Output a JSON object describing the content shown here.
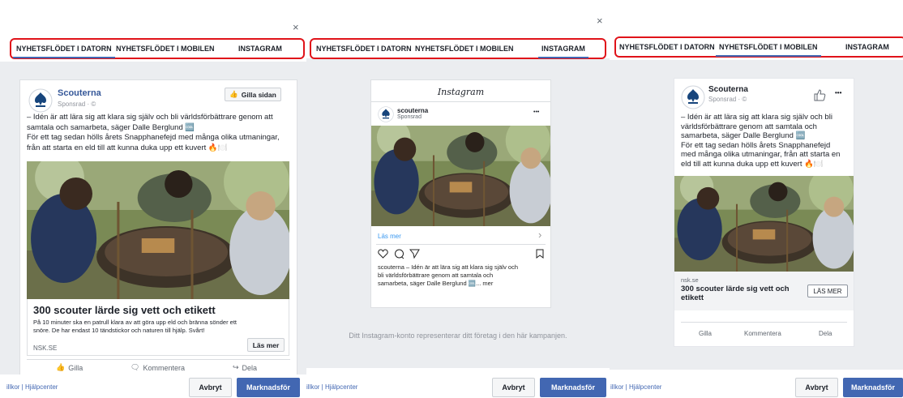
{
  "tabs": {
    "desktop": "NYHETSFLÖDET I DATORN",
    "mobile": "NYHETSFLÖDET I MOBILEN",
    "instagram": "INSTAGRAM"
  },
  "close_glyph": "×",
  "ad": {
    "page_name": "Scouterna",
    "sponsored": "Sponsrad · ©",
    "like_page": "Gilla sidan",
    "text_lines": [
      "– Idén är att lära sig att klara sig själv och bli världsförbättrare genom att",
      "samtala och samarbeta, säger Dalle Berglund 🆒",
      "För ett tag sedan hölls årets Snapphanefejd med många olika utmaningar,",
      "från att starta en eld till att kunna duka upp ett kuvert 🔥🍽️"
    ],
    "headline": "300 scouter lärde sig vett och etikett",
    "description_lines": [
      "På 10 minuter ska en patrull klara av att göra upp eld och bränna sönder ett",
      "snöre. De har endast 10 tändstickor och naturen till hjälp. Svårt!"
    ],
    "domain_upper": "NSK.SE",
    "cta": "Läs mer",
    "actions": {
      "like": "Gilla",
      "comment": "Kommentera",
      "share": "Dela"
    }
  },
  "instagram": {
    "logo_text": "Instagram",
    "account": "scouterna",
    "sponsored": "Sponsrad",
    "more_dots": "•••",
    "las_mer": "Läs mer",
    "chevron": "›",
    "caption_lines": [
      "scouterna – Idén är att lära sig att klara sig själv och",
      "bli världsförbättrare genom att samtala och",
      "samarbeta, säger Dalle Berglund 🆒... mer"
    ],
    "notice": "Ditt Instagram-konto representerar ditt företag i den här kampanjen."
  },
  "mobile": {
    "page_name": "Scouterna",
    "sponsored": "Sponsrad · ©",
    "text_lines": [
      "– Idén är att lära sig att klara sig själv och bli",
      "världsförbättrare genom att samtala och",
      "samarbeta, säger Dalle Berglund 🆒",
      "För ett tag sedan hölls årets Snapphanefejd",
      "med många olika utmaningar, från att starta en",
      "eld till att kunna duka upp ett kuvert 🔥🍽️"
    ],
    "domain": "nsk.se",
    "headline_lines": [
      "300 scouter lärde sig vett och",
      "etikett"
    ],
    "cta": "LÄS MER",
    "actions": {
      "like": "Gilla",
      "comment": "Kommentera",
      "share": "Dela"
    },
    "more_dots": "•••"
  },
  "footer": {
    "links_1": "illkor  |  Hjälpcenter",
    "links_2": "illkor  |  Hjälpcenter",
    "links_3": "illkor  |  Hjälpcenter",
    "cancel": "Avbryt",
    "submit": "Marknadsför"
  },
  "colors": {
    "brand_blue": "#4267b2",
    "highlight_red": "#e0131a",
    "link_blue": "#365899"
  }
}
